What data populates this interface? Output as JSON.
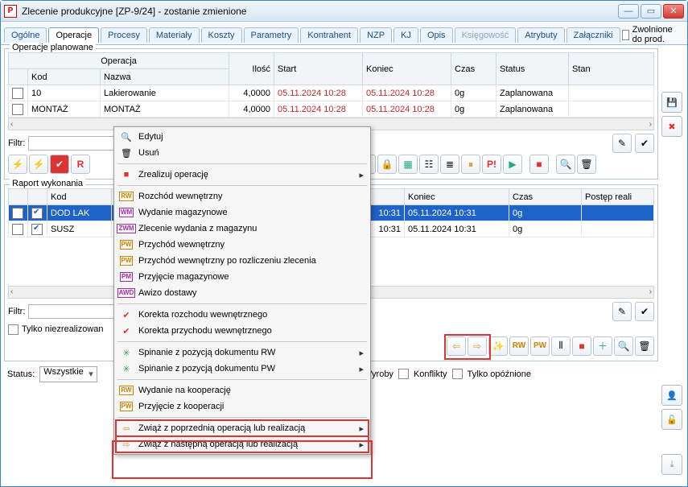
{
  "window": {
    "title": "Zlecenie produkcyjne  [ZP-9/24] - zostanie zmienione"
  },
  "tabs": {
    "items": [
      "Ogólne",
      "Operacje",
      "Procesy",
      "Materiały",
      "Koszty",
      "Parametry",
      "Kontrahent",
      "NZP",
      "KJ",
      "Opis",
      "Księgowość",
      "Atrybuty",
      "Załączniki"
    ],
    "active_index": 1,
    "release_label": "Zwolnione do prod."
  },
  "planned": {
    "group_title": "Operacje planowane",
    "super_header": "Operacja",
    "columns": [
      "",
      "Kod",
      "Nazwa",
      "Ilość",
      "Start",
      "Koniec",
      "Czas",
      "Status",
      "Stan"
    ],
    "rows": [
      {
        "checked": false,
        "kod": "10",
        "nazwa": "Lakierowanie",
        "ilosc": "4,0000",
        "start": "05.11.2024 10:28",
        "koniec": "05.11.2024 10:28",
        "czas": "0g",
        "status": "Zaplanowana",
        "stan": ""
      },
      {
        "checked": false,
        "kod": "MONTAŻ",
        "nazwa": "MONTAŻ",
        "ilosc": "4,0000",
        "start": "05.11.2024 10:28",
        "koniec": "05.11.2024 10:28",
        "czas": "0g",
        "status": "Zaplanowana",
        "stan": ""
      }
    ],
    "filter_label": "Filtr:"
  },
  "report": {
    "group_title": "Raport wykonania",
    "columns": [
      "",
      "",
      "Kod",
      "",
      "Koniec",
      "Czas",
      "Postęp reali"
    ],
    "rows": [
      {
        "checked": true,
        "kod": "DOD LAK",
        "start_tail": "10:31",
        "koniec": "05.11.2024 10:31",
        "czas": "0g",
        "selected": true
      },
      {
        "checked": true,
        "kod": "SUSZ",
        "start_tail": "10:31",
        "koniec": "05.11.2024 10:31",
        "czas": "0g",
        "selected": false
      }
    ],
    "filter_label": "Filtr:",
    "only_unrealized_label": "Tylko niezrealizowan"
  },
  "status_bar": {
    "label": "Status:",
    "value": "Wszystkie",
    "chk_wyroby": "Wyroby",
    "chk_konflikty": "Konflikty",
    "chk_opoznione": "Tylko opóźnione"
  },
  "context_menu": {
    "items": [
      {
        "icon": "🔍",
        "label": "Edytuj"
      },
      {
        "icon": "🗑",
        "label": "Usuń"
      },
      {
        "sep": true
      },
      {
        "icon": "■",
        "icon_color": "#d33",
        "label": "Zrealizuj operację",
        "submenu": true
      },
      {
        "sep": true
      },
      {
        "tag": "RW",
        "tag_cls": "rw",
        "label": "Rozchód wewnętrzny"
      },
      {
        "tag": "WM",
        "tag_cls": "wm",
        "label": "Wydanie magazynowe"
      },
      {
        "tag": "ZWM",
        "tag_cls": "zwm",
        "label": "Zlecenie wydania z magazynu"
      },
      {
        "tag": "PW",
        "tag_cls": "pw",
        "label": "Przychód wewnętrzny"
      },
      {
        "tag": "PW",
        "tag_cls": "pw",
        "label": "Przychód wewnętrzny po rozliczeniu zlecenia"
      },
      {
        "tag": "PM",
        "tag_cls": "pm",
        "label": "Przyjęcie magazynowe"
      },
      {
        "tag": "AWD",
        "tag_cls": "awd",
        "label": "Awizo dostawy"
      },
      {
        "sep": true
      },
      {
        "icon": "✔",
        "icon_color": "#d33",
        "label": "Korekta rozchodu wewnętrznego"
      },
      {
        "icon": "✔",
        "icon_color": "#d33",
        "label": "Korekta przychodu wewnętrznego"
      },
      {
        "sep": true
      },
      {
        "icon": "✳",
        "icon_color": "#3a9a3a",
        "label": "Spinanie z pozycją dokumentu RW",
        "submenu": true
      },
      {
        "icon": "✳",
        "icon_color": "#3a9a3a",
        "label": "Spinanie z pozycją dokumentu PW",
        "submenu": true
      },
      {
        "sep": true
      },
      {
        "tag": "RW",
        "tag_cls": "rw",
        "label": "Wydanie na kooperację"
      },
      {
        "tag": "PW",
        "tag_cls": "pw",
        "label": "Przyjęcie z kooperacji"
      },
      {
        "sep": true
      },
      {
        "icon": "⇦",
        "icon_color": "#e0a030",
        "label": "Zwiąż z poprzednią operacją lub realizacją",
        "submenu": true,
        "hl": true
      },
      {
        "icon": "⇨",
        "icon_color": "#e0a030",
        "label": "Zwiąż z następną operacją lub realizacją",
        "submenu": true,
        "hl": true
      }
    ]
  }
}
